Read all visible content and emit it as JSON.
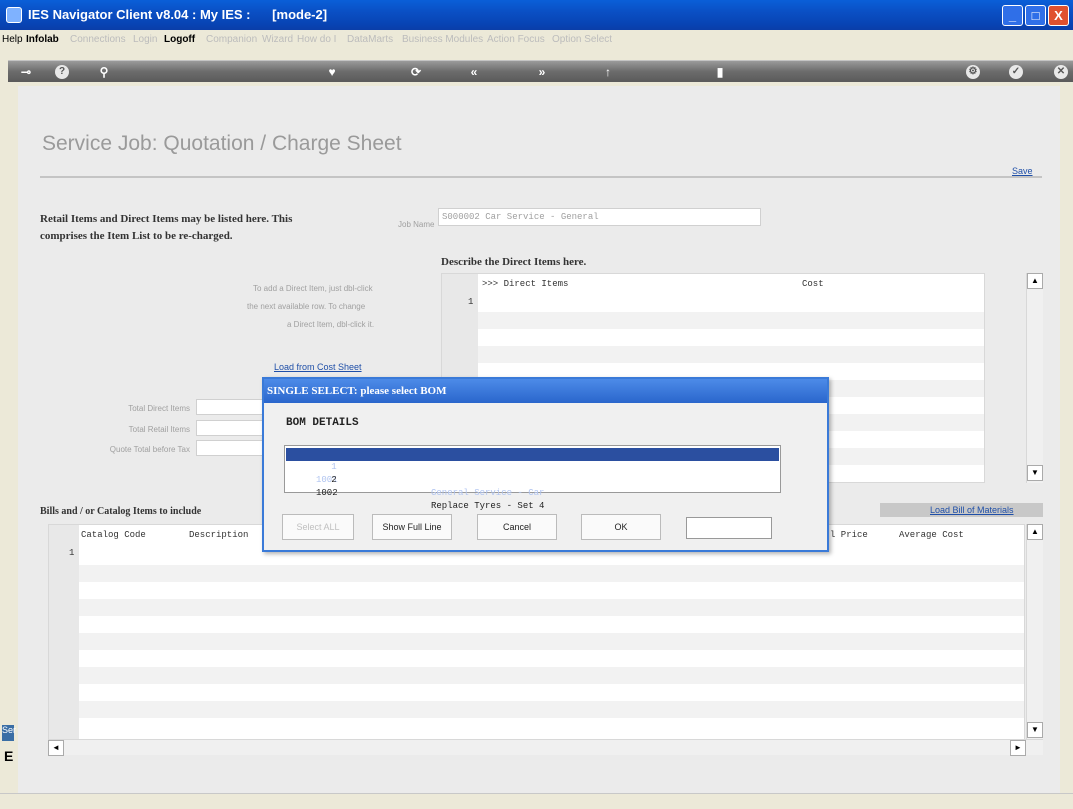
{
  "window": {
    "title": "IES Navigator Client v8.04 : My IES :      [mode-2]",
    "min": "_",
    "max": "□",
    "close": "X"
  },
  "menu": {
    "items": [
      {
        "label": "Help",
        "dim": false
      },
      {
        "label": "Infolab",
        "dim": false
      },
      {
        "label": "Connections",
        "dim": true
      },
      {
        "label": "Login",
        "dim": true
      },
      {
        "label": "Logoff",
        "dim": false
      },
      {
        "label": "Companion",
        "dim": true
      },
      {
        "label": "Wizard",
        "dim": true
      },
      {
        "label": "How do I",
        "dim": true
      },
      {
        "label": "DataMarts",
        "dim": true
      },
      {
        "label": "Business Modules",
        "dim": true
      },
      {
        "label": "Action Focus",
        "dim": true
      },
      {
        "label": "Option Select",
        "dim": true
      }
    ]
  },
  "toolbar": {
    "icons": [
      {
        "name": "key-icon",
        "glyph": "⊸"
      },
      {
        "name": "help-icon",
        "glyph": "?"
      },
      {
        "name": "search-icon",
        "glyph": "⚲"
      },
      {
        "name": "favorite-icon",
        "glyph": "♥"
      },
      {
        "name": "refresh-icon",
        "glyph": "⟳"
      },
      {
        "name": "back-icon",
        "glyph": "«"
      },
      {
        "name": "forward-icon",
        "glyph": "»"
      },
      {
        "name": "up-icon",
        "glyph": "↑"
      },
      {
        "name": "block-icon",
        "glyph": "▮"
      },
      {
        "name": "settings-icon",
        "glyph": "⚙"
      },
      {
        "name": "confirm-icon",
        "glyph": "✓"
      },
      {
        "name": "close-icon",
        "glyph": "✕"
      }
    ]
  },
  "page": {
    "title": "Service Job: Quotation / Charge Sheet",
    "save": "Save",
    "intro": "Retail Items and Direct Items may be listed here. This comprises the Item List to be re-charged.",
    "job_name_label": "Job Name",
    "job_name_value": "S000002 Car Service - General",
    "direct_title": "Describe the Direct Items here.",
    "direct_help": [
      "To add a Direct Item, just dbl-click",
      "the next available row. To change",
      "a Direct Item, dbl-click it."
    ],
    "load_cost_sheet": "Load from Cost Sheet",
    "totals": [
      "Total Direct Items",
      "Total Retail Items",
      "Quote Total before Tax"
    ],
    "direct_grid": {
      "col_items": ">>> Direct Items",
      "col_cost": "Cost",
      "row_num": "1"
    },
    "bills_title": "Bills and / or Catalog Items to include",
    "load_bom": "Load Bill of Materials",
    "catalog_grid": {
      "col_code": "Catalog Code",
      "col_desc": "Description",
      "col_price": "l Price",
      "col_avg": "Average Cost",
      "row_num": "1"
    },
    "scroll_up": "▲",
    "scroll_down": "▼",
    "scroll_left": "◄",
    "scroll_right": "►",
    "side_tab": "Ser",
    "side_letter": "E"
  },
  "dialog": {
    "title": "SINGLE SELECT: please select BOM",
    "heading": "BOM DETAILS",
    "rows": [
      {
        "num": "1",
        "code": "1001",
        "desc": "General Service - Car",
        "selected": true
      },
      {
        "num": "2",
        "code": "1002",
        "desc": "Replace Tyres - Set 4",
        "selected": false
      }
    ],
    "buttons": {
      "select_all": "Select ALL",
      "show_full_line": "Show Full Line",
      "cancel": "Cancel",
      "ok": "OK"
    }
  }
}
